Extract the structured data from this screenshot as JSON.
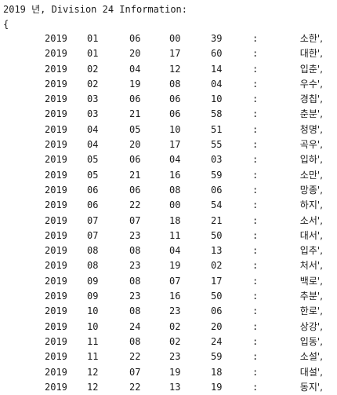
{
  "header": {
    "title": "2019 년, Division 24 Information:",
    "open_brace": "{"
  },
  "rows": [
    {
      "year": "2019",
      "month": "01",
      "day": "06",
      "hour": "00",
      "minute": "39",
      "sep": ":",
      "term": "소한',"
    },
    {
      "year": "2019",
      "month": "01",
      "day": "20",
      "hour": "17",
      "minute": "60",
      "sep": ":",
      "term": "대한',"
    },
    {
      "year": "2019",
      "month": "02",
      "day": "04",
      "hour": "12",
      "minute": "14",
      "sep": ":",
      "term": "입춘',"
    },
    {
      "year": "2019",
      "month": "02",
      "day": "19",
      "hour": "08",
      "minute": "04",
      "sep": ":",
      "term": "우수',"
    },
    {
      "year": "2019",
      "month": "03",
      "day": "06",
      "hour": "06",
      "minute": "10",
      "sep": ":",
      "term": "경칩',"
    },
    {
      "year": "2019",
      "month": "03",
      "day": "21",
      "hour": "06",
      "minute": "58",
      "sep": ":",
      "term": "춘분',"
    },
    {
      "year": "2019",
      "month": "04",
      "day": "05",
      "hour": "10",
      "minute": "51",
      "sep": ":",
      "term": "청명',"
    },
    {
      "year": "2019",
      "month": "04",
      "day": "20",
      "hour": "17",
      "minute": "55",
      "sep": ":",
      "term": "곡우',"
    },
    {
      "year": "2019",
      "month": "05",
      "day": "06",
      "hour": "04",
      "minute": "03",
      "sep": ":",
      "term": "입하',"
    },
    {
      "year": "2019",
      "month": "05",
      "day": "21",
      "hour": "16",
      "minute": "59",
      "sep": ":",
      "term": "소만',"
    },
    {
      "year": "2019",
      "month": "06",
      "day": "06",
      "hour": "08",
      "minute": "06",
      "sep": ":",
      "term": "망종',"
    },
    {
      "year": "2019",
      "month": "06",
      "day": "22",
      "hour": "00",
      "minute": "54",
      "sep": ":",
      "term": "하지',"
    },
    {
      "year": "2019",
      "month": "07",
      "day": "07",
      "hour": "18",
      "minute": "21",
      "sep": ":",
      "term": "소서',"
    },
    {
      "year": "2019",
      "month": "07",
      "day": "23",
      "hour": "11",
      "minute": "50",
      "sep": ":",
      "term": "대서',"
    },
    {
      "year": "2019",
      "month": "08",
      "day": "08",
      "hour": "04",
      "minute": "13",
      "sep": ":",
      "term": "입추',"
    },
    {
      "year": "2019",
      "month": "08",
      "day": "23",
      "hour": "19",
      "minute": "02",
      "sep": ":",
      "term": "처서',"
    },
    {
      "year": "2019",
      "month": "09",
      "day": "08",
      "hour": "07",
      "minute": "17",
      "sep": ":",
      "term": "백로',"
    },
    {
      "year": "2019",
      "month": "09",
      "day": "23",
      "hour": "16",
      "minute": "50",
      "sep": ":",
      "term": "추분',"
    },
    {
      "year": "2019",
      "month": "10",
      "day": "08",
      "hour": "23",
      "minute": "06",
      "sep": ":",
      "term": "한로',"
    },
    {
      "year": "2019",
      "month": "10",
      "day": "24",
      "hour": "02",
      "minute": "20",
      "sep": ":",
      "term": "상강',"
    },
    {
      "year": "2019",
      "month": "11",
      "day": "08",
      "hour": "02",
      "minute": "24",
      "sep": ":",
      "term": "입동',"
    },
    {
      "year": "2019",
      "month": "11",
      "day": "22",
      "hour": "23",
      "minute": "59",
      "sep": ":",
      "term": "소설',"
    },
    {
      "year": "2019",
      "month": "12",
      "day": "07",
      "hour": "19",
      "minute": "18",
      "sep": ":",
      "term": "대설',"
    },
    {
      "year": "2019",
      "month": "12",
      "day": "22",
      "hour": "13",
      "minute": "19",
      "sep": ":",
      "term": "동지',"
    }
  ]
}
